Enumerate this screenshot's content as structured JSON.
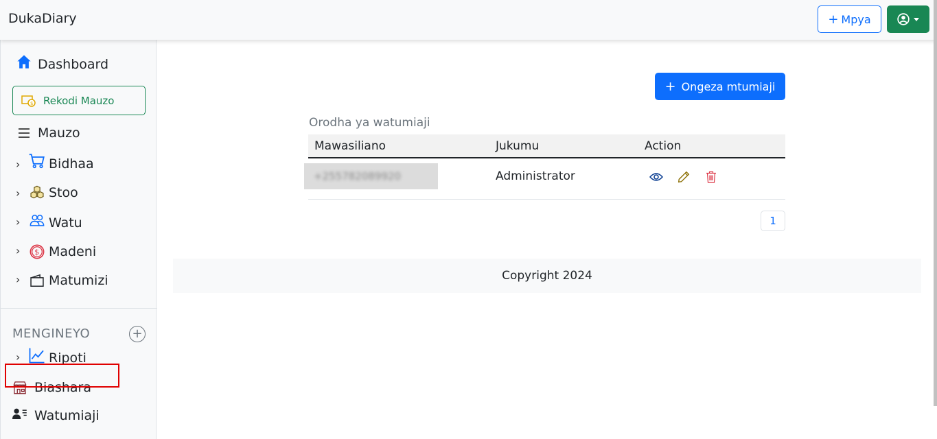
{
  "app": {
    "title": "DukaDiary"
  },
  "topbar": {
    "new_label": "Mpya"
  },
  "sidebar": {
    "dashboard": "Dashboard",
    "rekodi": "Rekodi Mauzo",
    "mauzo": "Mauzo",
    "items": [
      {
        "label": "Bidhaa",
        "icon": "cart-icon"
      },
      {
        "label": "Stoo",
        "icon": "boxes-icon"
      },
      {
        "label": "Watu",
        "icon": "people-icon"
      },
      {
        "label": "Madeni",
        "icon": "dollar-circle-icon"
      },
      {
        "label": "Matumizi",
        "icon": "wallet-icon"
      }
    ],
    "section_title": "MENGINEYO",
    "ripoti": "Ripoti",
    "biashara": "Biashara",
    "watumiaji": "Watumiaji"
  },
  "main": {
    "add_button": "Ongeza mtumiaji",
    "caption": "Orodha ya watumiaji",
    "columns": [
      "Mawasiliano",
      "Jukumu",
      "Action"
    ],
    "rows": [
      {
        "contact": "+255782089920",
        "role": "Administrator"
      }
    ],
    "page": "1"
  },
  "footer": {
    "text": "Copyright 2024"
  },
  "colors": {
    "primary": "#0d6efd",
    "success": "#198754",
    "danger": "#dc3545",
    "warning": "#b58a00"
  }
}
